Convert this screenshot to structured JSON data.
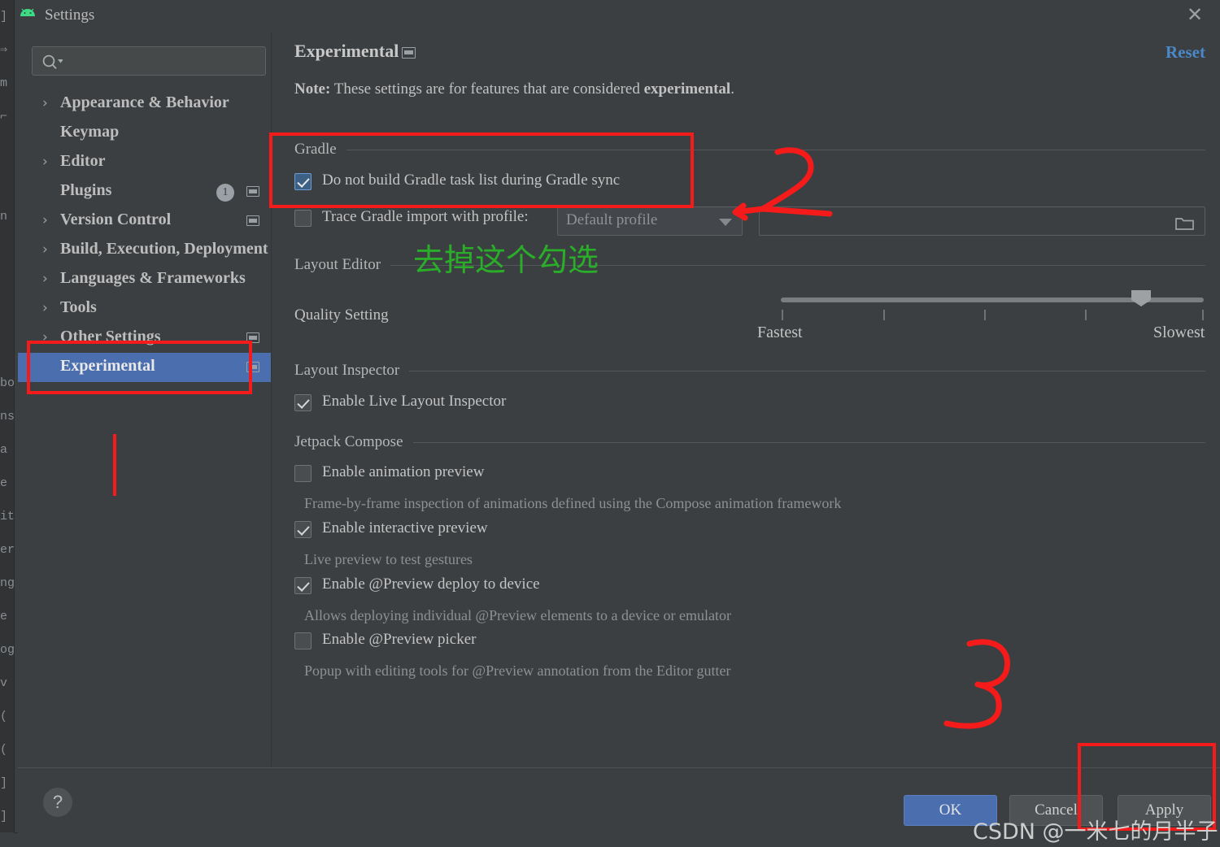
{
  "window": {
    "title": "Settings",
    "logo_icon": "android-logo-icon",
    "close_icon": "close-icon"
  },
  "sidebar": {
    "search": {
      "placeholder": "",
      "value": "",
      "icon": "search-icon"
    },
    "items": [
      {
        "label": "Appearance & Behavior",
        "expandable": true,
        "selected": false
      },
      {
        "label": "Keymap",
        "expandable": false,
        "selected": false
      },
      {
        "label": "Editor",
        "expandable": true,
        "selected": false
      },
      {
        "label": "Plugins",
        "expandable": false,
        "selected": false,
        "badge": "1",
        "window_icon": true
      },
      {
        "label": "Version Control",
        "expandable": true,
        "selected": false,
        "window_icon": true
      },
      {
        "label": "Build, Execution, Deployment",
        "expandable": true,
        "selected": false
      },
      {
        "label": "Languages & Frameworks",
        "expandable": true,
        "selected": false
      },
      {
        "label": "Tools",
        "expandable": true,
        "selected": false
      },
      {
        "label": "Other Settings",
        "expandable": true,
        "selected": false,
        "window_icon": true
      },
      {
        "label": "Experimental",
        "expandable": false,
        "selected": true,
        "window_icon": true
      }
    ]
  },
  "main": {
    "page_title": "Experimental",
    "page_title_icon": "window-mode-icon",
    "reset_label": "Reset",
    "note_prefix": "Note:",
    "note_body": " These settings are for features that are considered ",
    "note_emphasis": "experimental",
    "note_suffix": ".",
    "groups": {
      "gradle": {
        "title": "Gradle",
        "checkbox_no_task_list": {
          "label": "Do not build Gradle task list during Gradle sync",
          "checked": true
        },
        "checkbox_trace": {
          "label": "Trace Gradle import with profile:",
          "checked": false
        },
        "profile_combo": {
          "value": "Default profile",
          "icon": "chevron-down-icon"
        },
        "profile_path": {
          "value": "",
          "placeholder": "",
          "icon": "folder-icon"
        }
      },
      "layout_editor": {
        "title": "Layout Editor",
        "quality_label": "Quality Setting",
        "slider": {
          "min_label": "Fastest",
          "max_label": "Slowest",
          "ticks": 5,
          "value_percent": 87
        }
      },
      "layout_inspector": {
        "title": "Layout Inspector",
        "checkbox_live": {
          "label": "Enable Live Layout Inspector",
          "checked": true
        }
      },
      "jetpack_compose": {
        "title": "Jetpack Compose",
        "options": [
          {
            "label": "Enable animation preview",
            "checked": false,
            "description": "Frame-by-frame inspection of animations defined using the Compose animation framework"
          },
          {
            "label": "Enable interactive preview",
            "checked": true,
            "description": "Live preview to test gestures"
          },
          {
            "label": "Enable @Preview deploy to device",
            "checked": true,
            "description": "Allows deploying individual @Preview elements to a device or emulator"
          },
          {
            "label": "Enable @Preview picker",
            "checked": false,
            "description": "Popup with editing tools for @Preview annotation from the Editor gutter"
          }
        ]
      }
    }
  },
  "bottom_bar": {
    "help_label": "?",
    "ok_label": "OK",
    "cancel_label": "Cancel",
    "apply_label": "Apply"
  },
  "annotations": {
    "green_note": "去掉这个勾选",
    "step_2": "2",
    "step_3": "3",
    "colors": {
      "red": "#f61b1b",
      "green": "#2aae2a"
    }
  },
  "watermark": {
    "text": "CSDN @一米七的月半子"
  },
  "background": {
    "left_gutter_chars": "]\n⇒\nm\n⌐\n\n\nn\n\n\n\n\nbo\nns\na\ne\nit\ner\nng\ne\nog\nv\n(\n(\n]\n]\n]\n]\n]\nx\np\nog\nbl"
  }
}
